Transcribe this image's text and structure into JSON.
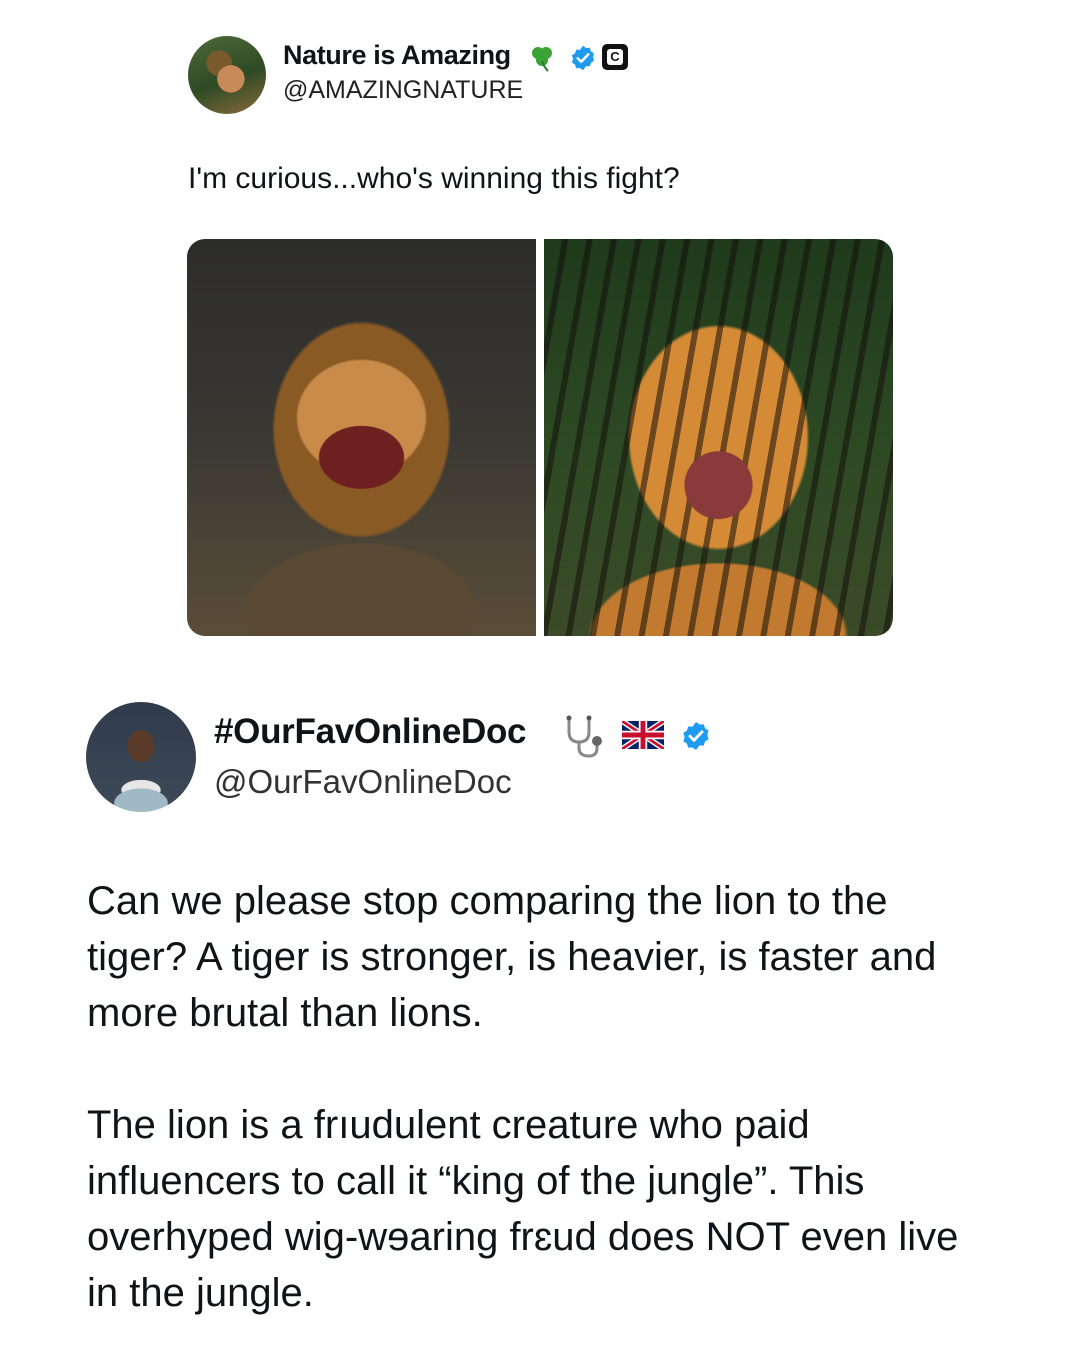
{
  "quoted_tweet": {
    "display_name": "Nature is Amazing",
    "handle": "@AMAZINGNATURE",
    "text": "I'm curious...who's winning this fight?",
    "badges": [
      "shamrock-emoji",
      "verified-badge",
      "c-badge"
    ],
    "c_badge_letter": "C",
    "images": [
      "lion-photo",
      "tiger-photo"
    ]
  },
  "reply_tweet": {
    "display_name": "#OurFavOnlineDoc",
    "handle": "@OurFavOnlineDoc",
    "badges": [
      "stethoscope-emoji",
      "uk-flag-emoji",
      "verified-badge"
    ],
    "paragraph1": "Can we please stop comparing the lion to the\ntiger? A tiger is stronger, is heavier, is faster and\nmore brutal than lions.",
    "paragraph2": "The lion is a frıudulent creature who paid\ninfluencers to call it “king of the jungle”. This\noverhyped wig-wɘaring frɛud does NOT even live\nin the jungle."
  },
  "colors": {
    "verified_blue": "#1d9bf0",
    "text": "#0f1419",
    "shamrock_green": "#3aa335"
  }
}
